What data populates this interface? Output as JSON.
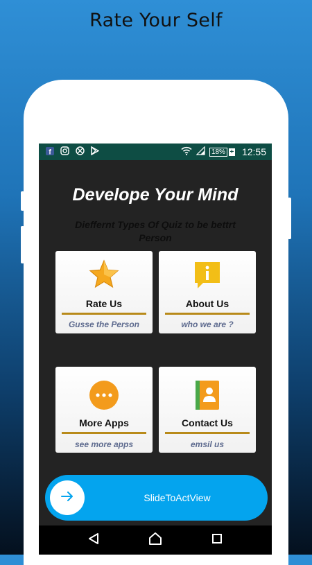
{
  "hero": {
    "title": "Rate Your Self"
  },
  "status_bar": {
    "icons": [
      "facebook-icon",
      "instagram-icon",
      "vpn-icon",
      "play-store-icon"
    ],
    "battery_percent": "18%",
    "battery_charging": "+",
    "time": "12:55"
  },
  "app": {
    "title": "Develope Your Mind",
    "subtitle": "Dieffernt Types Of Quiz to be bettrt Person"
  },
  "cards": [
    {
      "label": "Rate Us",
      "subtitle": "Gusse the Person",
      "icon": "star-icon"
    },
    {
      "label": "About Us",
      "subtitle": "who we are ?",
      "icon": "info-icon"
    },
    {
      "label": "More Apps",
      "subtitle": "see more apps",
      "icon": "more-icon"
    },
    {
      "label": "Contact Us",
      "subtitle": "emsil us",
      "icon": "contact-icon"
    }
  ],
  "slide_to_act": {
    "label": "SlideToActView",
    "icon": "arrow-right-icon"
  },
  "navbar": {
    "icons": [
      "back-icon",
      "home-icon",
      "recents-icon"
    ]
  },
  "colors": {
    "status_bar": "#0e4d44",
    "accent_rule": "#b88a1a",
    "slide_bar": "#04a4ee",
    "subtitle_text": "#5d6a8e"
  }
}
